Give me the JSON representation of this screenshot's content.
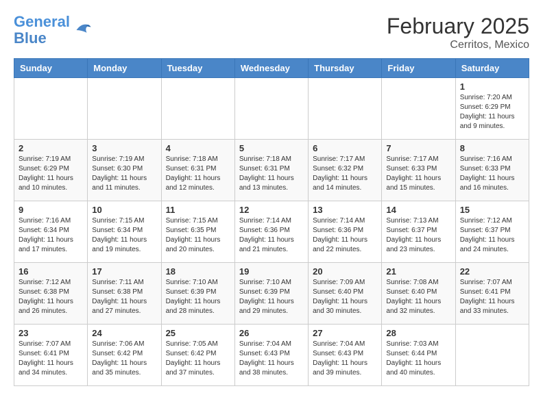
{
  "header": {
    "logo_line1": "General",
    "logo_line2": "Blue",
    "title": "February 2025",
    "subtitle": "Cerritos, Mexico"
  },
  "weekdays": [
    "Sunday",
    "Monday",
    "Tuesday",
    "Wednesday",
    "Thursday",
    "Friday",
    "Saturday"
  ],
  "weeks": [
    [
      {
        "day": "",
        "info": ""
      },
      {
        "day": "",
        "info": ""
      },
      {
        "day": "",
        "info": ""
      },
      {
        "day": "",
        "info": ""
      },
      {
        "day": "",
        "info": ""
      },
      {
        "day": "",
        "info": ""
      },
      {
        "day": "1",
        "info": "Sunrise: 7:20 AM\nSunset: 6:29 PM\nDaylight: 11 hours and 9 minutes."
      }
    ],
    [
      {
        "day": "2",
        "info": "Sunrise: 7:19 AM\nSunset: 6:29 PM\nDaylight: 11 hours and 10 minutes."
      },
      {
        "day": "3",
        "info": "Sunrise: 7:19 AM\nSunset: 6:30 PM\nDaylight: 11 hours and 11 minutes."
      },
      {
        "day": "4",
        "info": "Sunrise: 7:18 AM\nSunset: 6:31 PM\nDaylight: 11 hours and 12 minutes."
      },
      {
        "day": "5",
        "info": "Sunrise: 7:18 AM\nSunset: 6:31 PM\nDaylight: 11 hours and 13 minutes."
      },
      {
        "day": "6",
        "info": "Sunrise: 7:17 AM\nSunset: 6:32 PM\nDaylight: 11 hours and 14 minutes."
      },
      {
        "day": "7",
        "info": "Sunrise: 7:17 AM\nSunset: 6:33 PM\nDaylight: 11 hours and 15 minutes."
      },
      {
        "day": "8",
        "info": "Sunrise: 7:16 AM\nSunset: 6:33 PM\nDaylight: 11 hours and 16 minutes."
      }
    ],
    [
      {
        "day": "9",
        "info": "Sunrise: 7:16 AM\nSunset: 6:34 PM\nDaylight: 11 hours and 17 minutes."
      },
      {
        "day": "10",
        "info": "Sunrise: 7:15 AM\nSunset: 6:34 PM\nDaylight: 11 hours and 19 minutes."
      },
      {
        "day": "11",
        "info": "Sunrise: 7:15 AM\nSunset: 6:35 PM\nDaylight: 11 hours and 20 minutes."
      },
      {
        "day": "12",
        "info": "Sunrise: 7:14 AM\nSunset: 6:36 PM\nDaylight: 11 hours and 21 minutes."
      },
      {
        "day": "13",
        "info": "Sunrise: 7:14 AM\nSunset: 6:36 PM\nDaylight: 11 hours and 22 minutes."
      },
      {
        "day": "14",
        "info": "Sunrise: 7:13 AM\nSunset: 6:37 PM\nDaylight: 11 hours and 23 minutes."
      },
      {
        "day": "15",
        "info": "Sunrise: 7:12 AM\nSunset: 6:37 PM\nDaylight: 11 hours and 24 minutes."
      }
    ],
    [
      {
        "day": "16",
        "info": "Sunrise: 7:12 AM\nSunset: 6:38 PM\nDaylight: 11 hours and 26 minutes."
      },
      {
        "day": "17",
        "info": "Sunrise: 7:11 AM\nSunset: 6:38 PM\nDaylight: 11 hours and 27 minutes."
      },
      {
        "day": "18",
        "info": "Sunrise: 7:10 AM\nSunset: 6:39 PM\nDaylight: 11 hours and 28 minutes."
      },
      {
        "day": "19",
        "info": "Sunrise: 7:10 AM\nSunset: 6:39 PM\nDaylight: 11 hours and 29 minutes."
      },
      {
        "day": "20",
        "info": "Sunrise: 7:09 AM\nSunset: 6:40 PM\nDaylight: 11 hours and 30 minutes."
      },
      {
        "day": "21",
        "info": "Sunrise: 7:08 AM\nSunset: 6:40 PM\nDaylight: 11 hours and 32 minutes."
      },
      {
        "day": "22",
        "info": "Sunrise: 7:07 AM\nSunset: 6:41 PM\nDaylight: 11 hours and 33 minutes."
      }
    ],
    [
      {
        "day": "23",
        "info": "Sunrise: 7:07 AM\nSunset: 6:41 PM\nDaylight: 11 hours and 34 minutes."
      },
      {
        "day": "24",
        "info": "Sunrise: 7:06 AM\nSunset: 6:42 PM\nDaylight: 11 hours and 35 minutes."
      },
      {
        "day": "25",
        "info": "Sunrise: 7:05 AM\nSunset: 6:42 PM\nDaylight: 11 hours and 37 minutes."
      },
      {
        "day": "26",
        "info": "Sunrise: 7:04 AM\nSunset: 6:43 PM\nDaylight: 11 hours and 38 minutes."
      },
      {
        "day": "27",
        "info": "Sunrise: 7:04 AM\nSunset: 6:43 PM\nDaylight: 11 hours and 39 minutes."
      },
      {
        "day": "28",
        "info": "Sunrise: 7:03 AM\nSunset: 6:44 PM\nDaylight: 11 hours and 40 minutes."
      },
      {
        "day": "",
        "info": ""
      }
    ]
  ]
}
